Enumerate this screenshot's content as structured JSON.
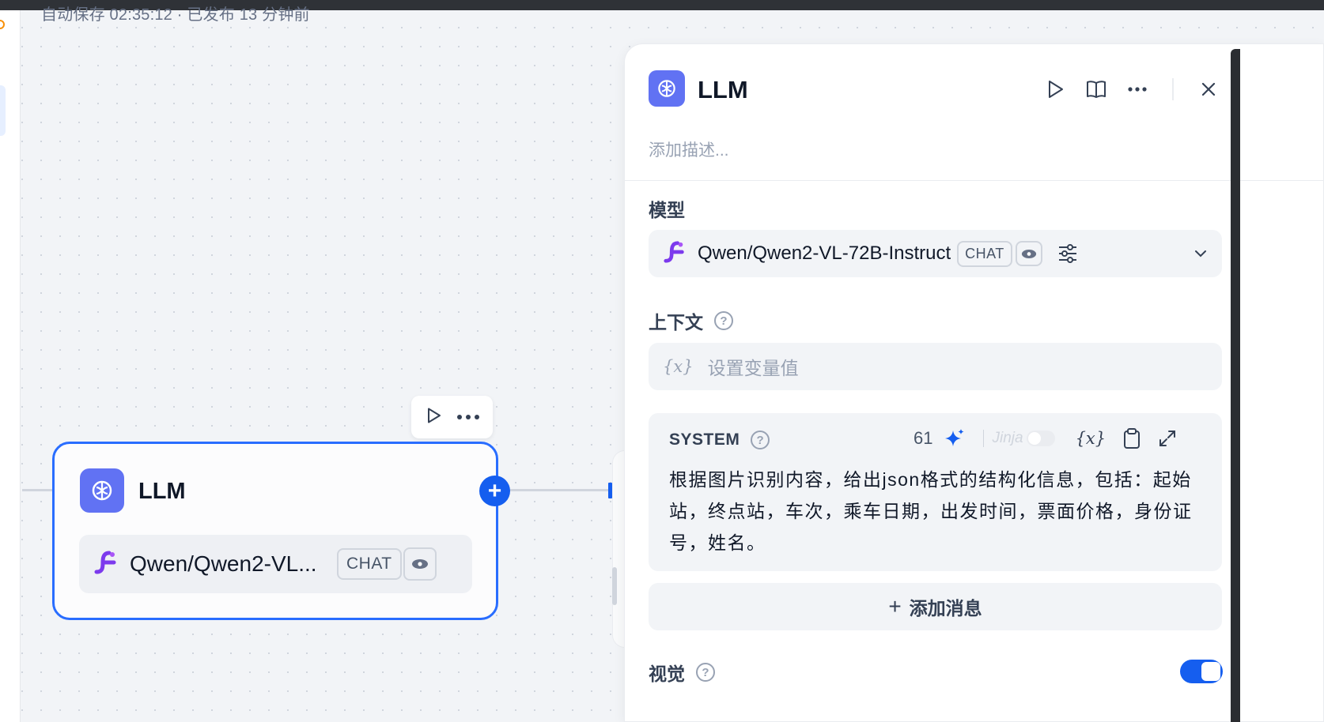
{
  "autosave_text": "自动保存 02:35:12 · 已发布 13 分钟前",
  "node": {
    "title": "LLM",
    "model_name": "Qwen/Qwen2-VL...",
    "mode_tag": "CHAT"
  },
  "panel": {
    "title": "LLM",
    "description_placeholder": "添加描述...",
    "model_section_label": "模型",
    "model_name": "Qwen/Qwen2-VL-72B-Instruct",
    "mode_tag": "CHAT",
    "context_label": "上下文",
    "context_placeholder": "设置变量值",
    "variable_glyph": "{x}",
    "system": {
      "label": "SYSTEM",
      "char_count": "61",
      "jinja_label": "Jinja",
      "prompt": "根据图片识别内容，给出json格式的结构化信息，包括：起始站，终点站，车次，乘车日期，出发时间，票面价格，身份证号，姓名。"
    },
    "add_message_label": "添加消息",
    "vision_label": "视觉",
    "vision_enabled": true
  },
  "colors": {
    "accent": "#155eef",
    "node_border": "#296dff",
    "icon_bg": "#6172f3",
    "model_logo": "#7c3aed"
  }
}
